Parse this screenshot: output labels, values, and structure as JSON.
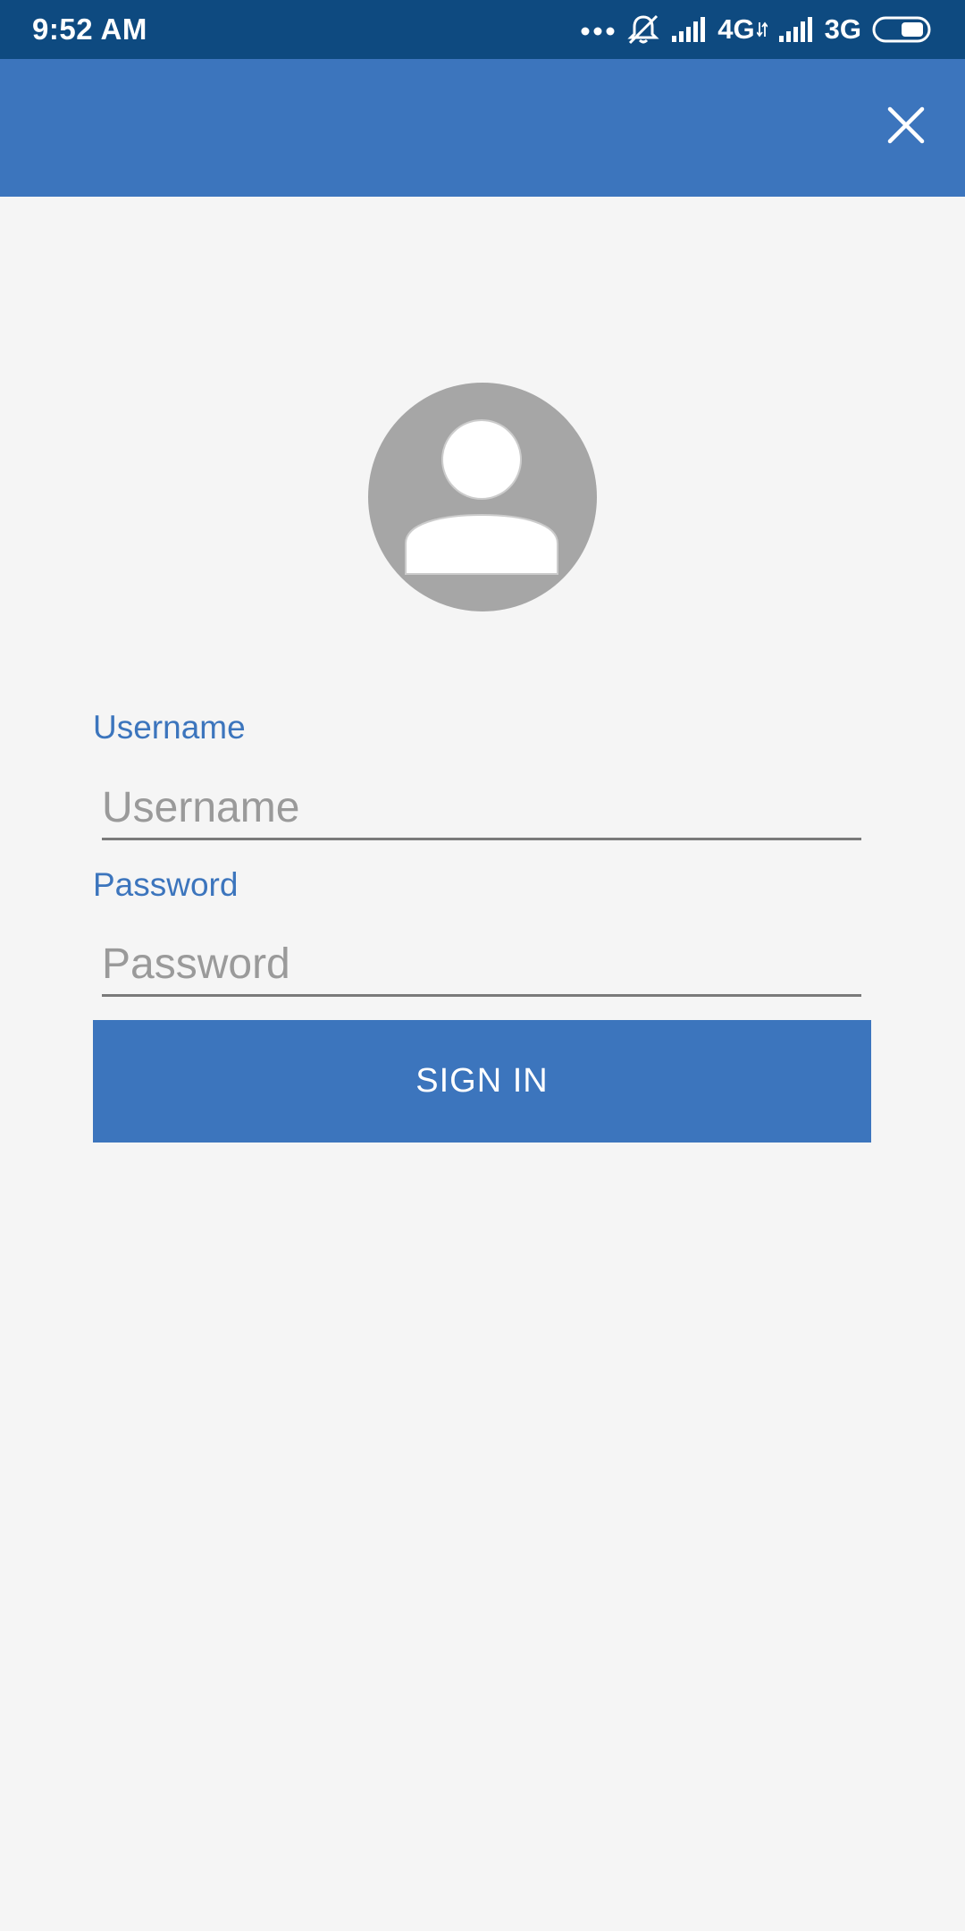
{
  "status_bar": {
    "time": "9:52 AM",
    "network_1": "4G",
    "network_2": "3G",
    "icons": [
      "more-dots-icon",
      "silent-bell-icon",
      "signal-icon",
      "data-arrows-icon",
      "signal-icon",
      "battery-icon"
    ]
  },
  "app_bar": {
    "close_icon": "close-icon",
    "color": "#3c75bd"
  },
  "avatar": {
    "icon": "person-icon",
    "color": "#a6a6a6"
  },
  "form": {
    "username_label": "Username",
    "username_placeholder": "Username",
    "username_value": "",
    "password_label": "Password",
    "password_placeholder": "Password",
    "password_value": "",
    "sign_in_label": "SIGN IN"
  },
  "colors": {
    "status_bar": "#0e4a80",
    "accent": "#3c75bd",
    "background": "#f5f5f5"
  }
}
